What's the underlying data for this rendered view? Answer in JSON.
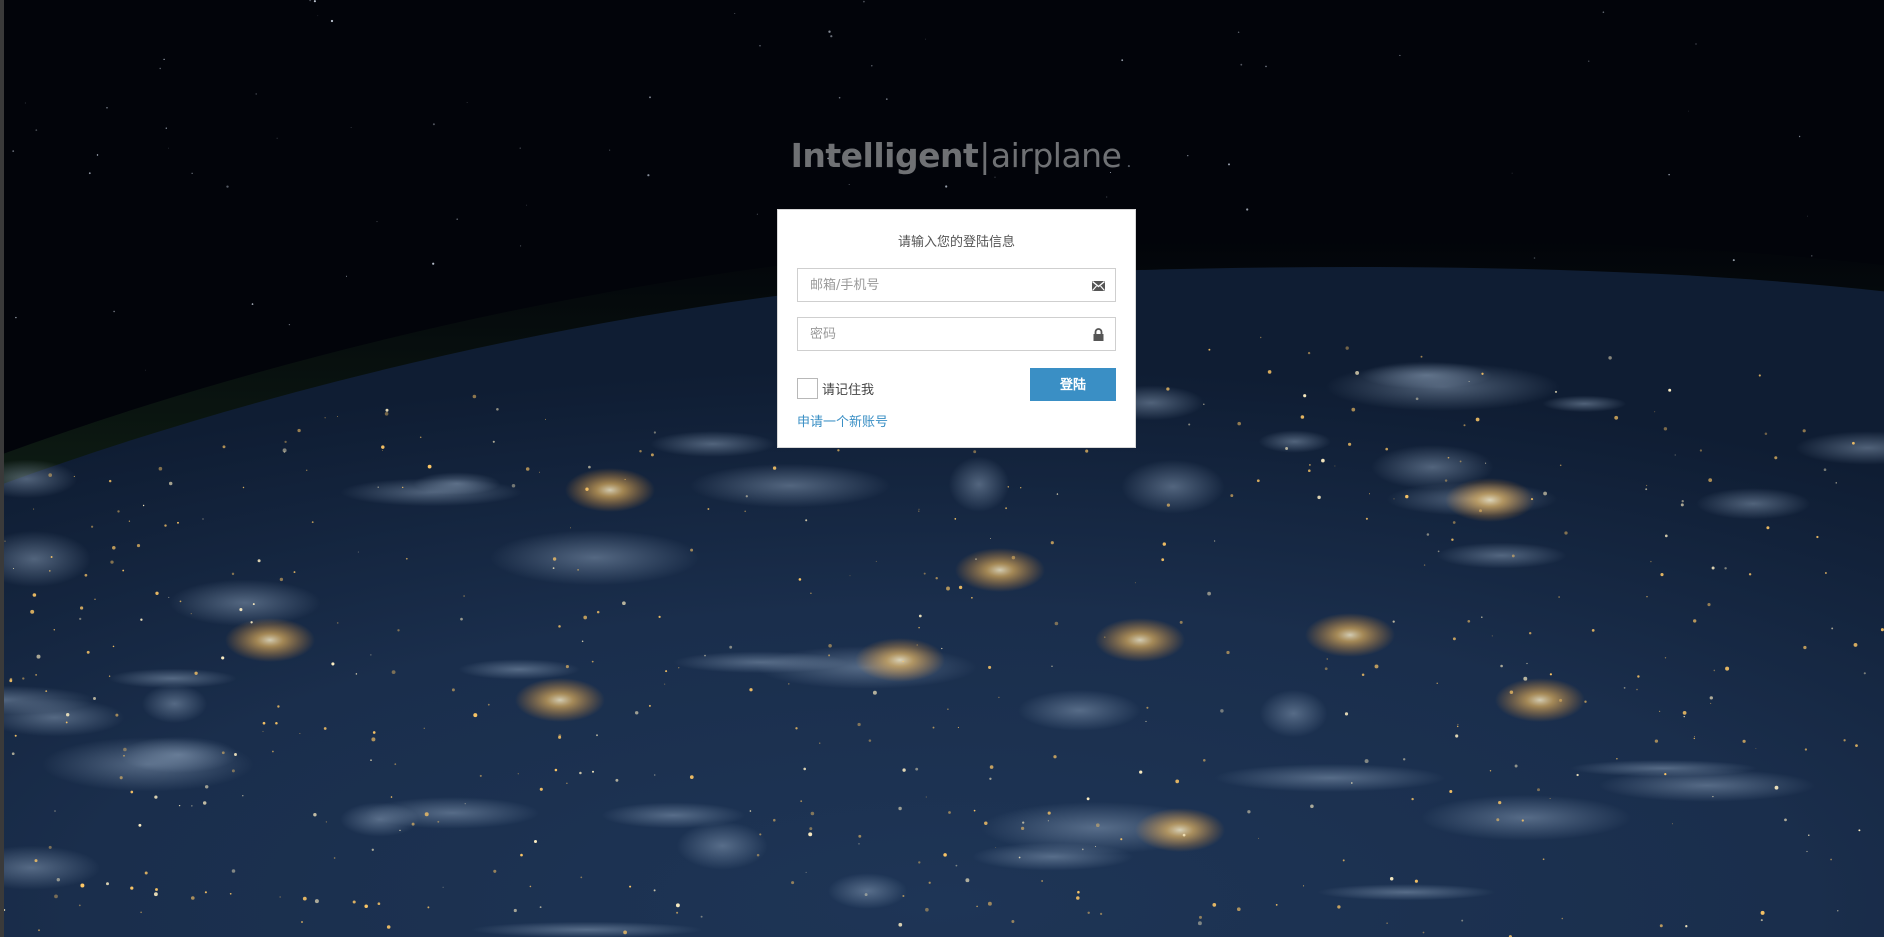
{
  "brand": {
    "bold": "Intelligent",
    "separator": "|",
    "light": "airplane"
  },
  "login": {
    "title": "请输入您的登陆信息",
    "email_placeholder": "邮箱/手机号",
    "password_placeholder": "密码",
    "remember_label": "请记住我",
    "submit_label": "登陆",
    "register_link": "申请一个新账号"
  },
  "icons": {
    "email": "envelope-icon",
    "password": "lock-icon"
  },
  "colors": {
    "accent": "#3a8fc5",
    "card_background": "#ffffff",
    "page_background": "#02040a"
  }
}
